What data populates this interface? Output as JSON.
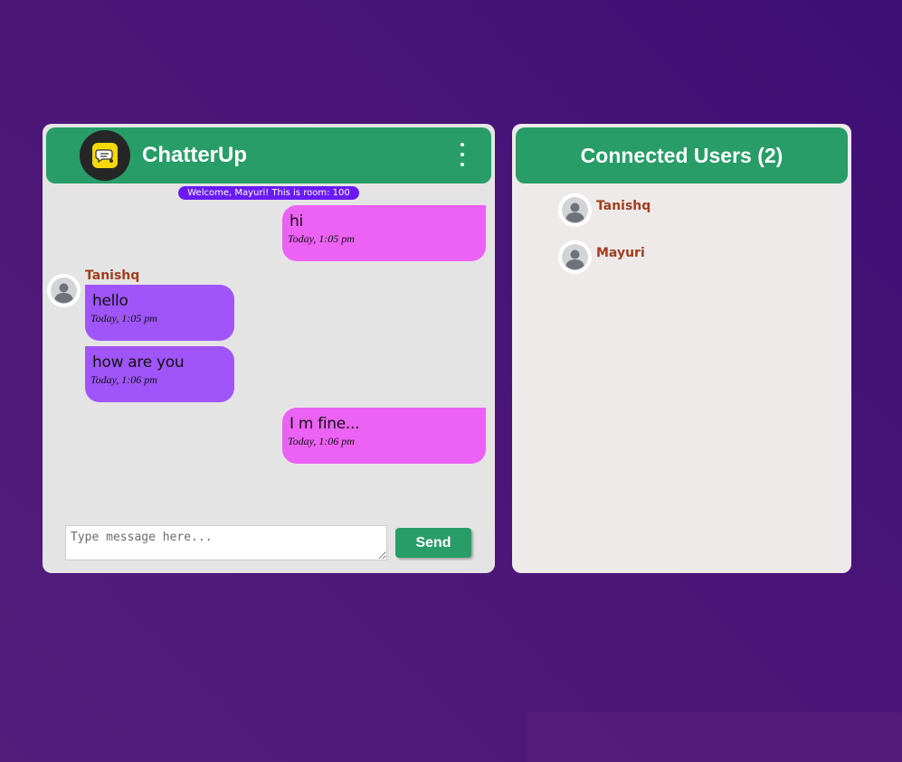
{
  "app": {
    "title": "ChatterUp",
    "logo_icon": "chat-bubbles-icon",
    "menu_icon": "kebab-menu-icon"
  },
  "welcome": "Welcome, Mayuri! This is room: 100",
  "messages": [
    {
      "sender": "me",
      "text": "hi",
      "time": "Today, 1:05 pm"
    },
    {
      "sender": "Tanishq",
      "text": "hello",
      "time": "Today, 1:05 pm"
    },
    {
      "sender": "Tanishq",
      "text": "how are you",
      "time": "Today, 1:06 pm"
    },
    {
      "sender": "me",
      "text": "I m fine...",
      "time": "Today, 1:06 pm"
    }
  ],
  "other_sender_name": "Tanishq",
  "composer": {
    "placeholder": "Type message here...",
    "send_label": "Send"
  },
  "users_panel": {
    "title": "Connected Users (2)",
    "users": [
      {
        "name": "Tanishq"
      },
      {
        "name": "Mayuri"
      }
    ]
  },
  "colors": {
    "header_green": "#289d68",
    "own_bubble": "#ec62f4",
    "other_bubble": "#a055fa",
    "welcome_pill": "#6a1bf5",
    "username": "#a03f1c",
    "background": "#4a1578"
  }
}
